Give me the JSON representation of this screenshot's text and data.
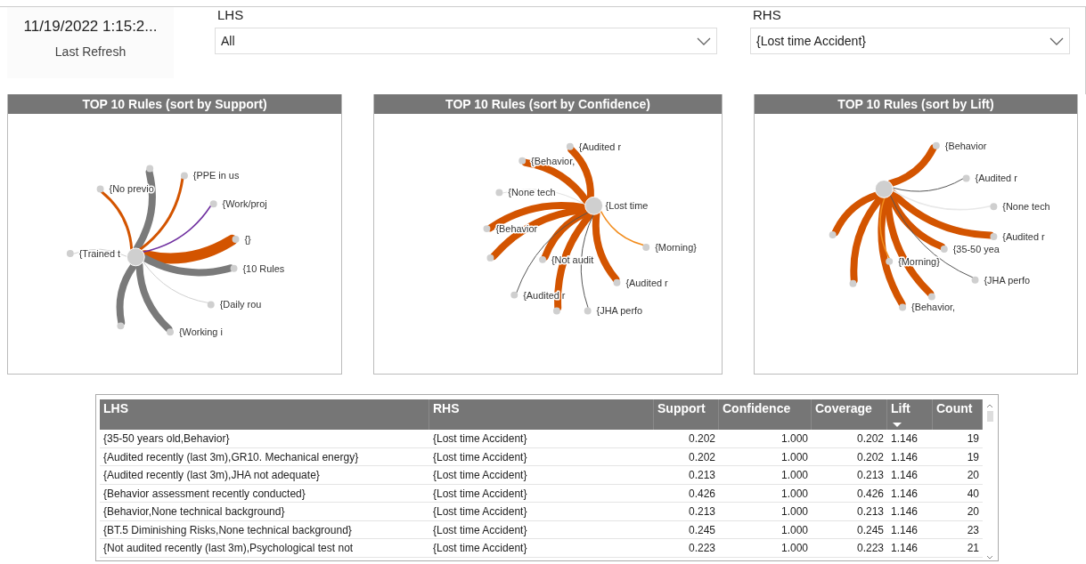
{
  "refresh": {
    "value": "11/19/2022 1:15:2...",
    "label": "Last Refresh"
  },
  "filters": [
    {
      "label": "LHS",
      "value": "All"
    },
    {
      "label": "RHS",
      "value": "{Lost time Accident}"
    }
  ],
  "charts": [
    {
      "title": "TOP 10 Rules (sort by Support)",
      "nodes": [
        {
          "label": "{No previo",
          "color": "#d35400",
          "kind": "medium"
        },
        {
          "color": "#7a7a7a",
          "kind": "thick"
        },
        {
          "label": "{PPE in us",
          "color": "#d35400",
          "kind": "medium"
        },
        {
          "label": "{Work/proj",
          "color": "#7030a0",
          "kind": "thin"
        },
        {
          "label": "{}",
          "color": "#d35400",
          "kind": "heavy"
        },
        {
          "label": "{10 Rules",
          "color": "#7a7a7a",
          "kind": "thick"
        },
        {
          "label": "{Daily rou",
          "color": "#d0d0d0",
          "kind": "hair"
        },
        {
          "label": "{Working i",
          "color": "#7a7a7a",
          "kind": "thick"
        },
        {
          "color": "#7a7a7a",
          "kind": "thick"
        },
        {
          "label": "{Trained t",
          "color": "#d0d0d0",
          "kind": "hair"
        }
      ]
    },
    {
      "title": "TOP 10 Rules (sort by Confidence)",
      "center_label": "{Lost time",
      "nodes": [
        {
          "label": "{Audited r",
          "color": "#d35400",
          "kind": "thick"
        },
        {
          "label": "{Behavior,",
          "color": "#d35400",
          "kind": "thick"
        },
        {
          "label": "{None tech",
          "color": "#e0e0e0",
          "kind": "hair"
        },
        {
          "label": "{Behavior",
          "color": "#d35400",
          "kind": "thick"
        },
        {
          "color": "#d35400",
          "kind": "thick"
        },
        {
          "label": "{Not audit",
          "color": "#d35400",
          "kind": "thick"
        },
        {
          "label": "{Audited r",
          "color": "#555555",
          "kind": "hair"
        },
        {
          "color": "#d35400",
          "kind": "thick"
        },
        {
          "label": "{JHA perfo",
          "color": "#555555",
          "kind": "hair"
        },
        {
          "label": "{Audited r",
          "color": "#d35400",
          "kind": "thick"
        },
        {
          "label": "{Morning}",
          "color": "#f28c1c",
          "kind": "thin"
        }
      ]
    },
    {
      "title": "TOP 10 Rules (sort by Lift)",
      "nodes": [
        {
          "label": "{Behavior",
          "color": "#d35400",
          "kind": "thick"
        },
        {
          "label": "{Audited r",
          "color": "#555555",
          "kind": "hair"
        },
        {
          "label": "{None tech",
          "color": "#e8e8e8",
          "kind": "thin"
        },
        {
          "label": "{Audited r",
          "color": "#d35400",
          "kind": "thick"
        },
        {
          "label": "{35-50 yea",
          "color": "#d35400",
          "kind": "thick"
        },
        {
          "label": "{Morning}",
          "color": "#f28c1c",
          "kind": "thin"
        },
        {
          "label": "{JHA perfo",
          "color": "#555555",
          "kind": "hair"
        },
        {
          "color": "#d35400",
          "kind": "thick"
        },
        {
          "label": "{Behavior,",
          "color": "#d35400",
          "kind": "thick"
        },
        {
          "color": "#d35400",
          "kind": "thick"
        },
        {
          "color": "#d35400",
          "kind": "thick"
        }
      ]
    }
  ],
  "table": {
    "columns": [
      {
        "label": "LHS",
        "sorted": false
      },
      {
        "label": "RHS",
        "sorted": false
      },
      {
        "label": "Support",
        "sorted": false
      },
      {
        "label": "Confidence",
        "sorted": false
      },
      {
        "label": "Coverage",
        "sorted": false
      },
      {
        "label": "Lift",
        "sorted": true
      },
      {
        "label": "Count",
        "sorted": false
      }
    ],
    "rows": [
      [
        "{35-50 years old,Behavior}",
        "{Lost time Accident}",
        "0.202",
        "1.000",
        "0.202",
        "1.146",
        "19"
      ],
      [
        "{Audited recently (last 3m),GR10. Mechanical energy}",
        "{Lost time Accident}",
        "0.202",
        "1.000",
        "0.202",
        "1.146",
        "19"
      ],
      [
        "{Audited recently (last 3m),JHA not adequate}",
        "{Lost time Accident}",
        "0.213",
        "1.000",
        "0.213",
        "1.146",
        "20"
      ],
      [
        "{Behavior assessment recently conducted}",
        "{Lost time Accident}",
        "0.426",
        "1.000",
        "0.426",
        "1.146",
        "40"
      ],
      [
        "{Behavior,None technical background}",
        "{Lost time Accident}",
        "0.213",
        "1.000",
        "0.213",
        "1.146",
        "20"
      ],
      [
        "{BT.5 Diminishing Risks,None technical background}",
        "{Lost time Accident}",
        "0.245",
        "1.000",
        "0.245",
        "1.146",
        "23"
      ],
      [
        "{Not audited recently (last 3m),Psychological test not",
        "{Lost time Accident}",
        "0.223",
        "1.000",
        "0.223",
        "1.146",
        "21"
      ]
    ]
  }
}
